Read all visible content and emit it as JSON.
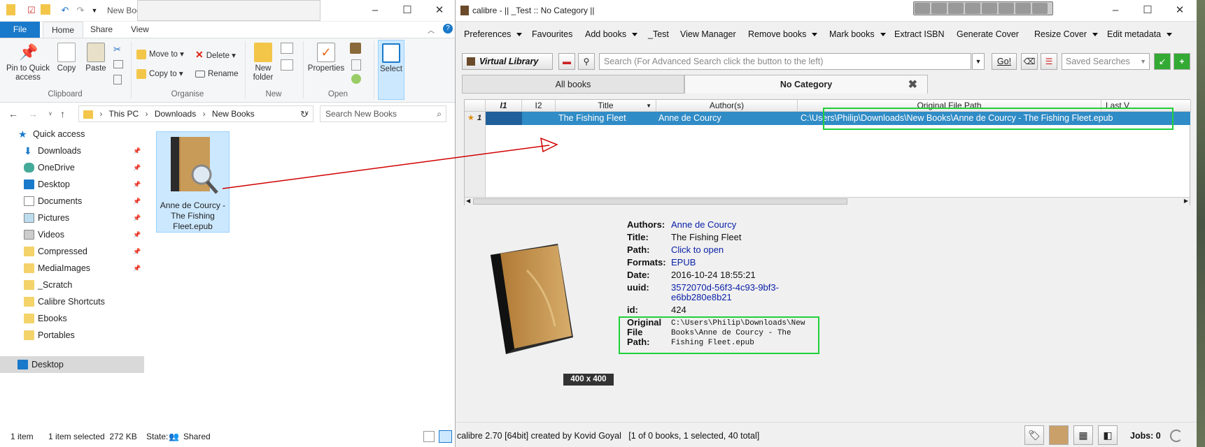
{
  "explorer": {
    "window_title": "New Books",
    "tabs": [
      "File",
      "Home",
      "Share",
      "View"
    ],
    "ribbon": {
      "clipboard": {
        "pin": "Pin to Quick access",
        "copy": "Copy",
        "paste": "Paste",
        "group": "Clipboard"
      },
      "organise": {
        "move_to": "Move to",
        "copy_to": "Copy to",
        "delete": "Delete",
        "rename": "Rename",
        "group": "Organise"
      },
      "new": {
        "new_folder": "New folder",
        "group": "New"
      },
      "open": {
        "properties": "Properties",
        "group": "Open"
      },
      "select": {
        "select": "Select"
      }
    },
    "breadcrumb": [
      "This PC",
      "Downloads",
      "New Books"
    ],
    "search_placeholder": "Search New Books",
    "nav_items": [
      {
        "label": "Quick access",
        "icon": "star-icon",
        "pinned": false
      },
      {
        "label": "Downloads",
        "icon": "download-icon",
        "pinned": true
      },
      {
        "label": "OneDrive",
        "icon": "cloud-icon",
        "pinned": true
      },
      {
        "label": "Desktop",
        "icon": "desktop-icon",
        "pinned": true
      },
      {
        "label": "Documents",
        "icon": "document-icon",
        "pinned": true
      },
      {
        "label": "Pictures",
        "icon": "picture-icon",
        "pinned": true
      },
      {
        "label": "Videos",
        "icon": "video-icon",
        "pinned": true
      },
      {
        "label": "Compressed",
        "icon": "folder-icon",
        "pinned": true
      },
      {
        "label": "MediaImages",
        "icon": "folder-icon",
        "pinned": true
      },
      {
        "label": "_Scratch",
        "icon": "folder-icon",
        "pinned": false
      },
      {
        "label": "Calibre Shortcuts",
        "icon": "folder-icon",
        "pinned": false
      },
      {
        "label": "Ebooks",
        "icon": "folder-icon",
        "pinned": false
      },
      {
        "label": "Portables",
        "icon": "folder-icon",
        "pinned": false
      },
      {
        "label": "Desktop",
        "icon": "desktop-icon",
        "pinned": false
      }
    ],
    "file": {
      "name": "Anne de Courcy - The Fishing Fleet.epub"
    },
    "status": {
      "items": "1 item",
      "selected": "1 item selected  272 KB",
      "state_label": "State:",
      "state_value": "Shared"
    }
  },
  "calibre": {
    "window_title": "calibre - || _Test :: No Category ||",
    "menu": [
      {
        "label": "Preferences",
        "arrow": true
      },
      {
        "label": "Favourites",
        "arrow": false
      },
      {
        "label": "Add books",
        "arrow": true
      },
      {
        "label": "_Test",
        "arrow": false
      },
      {
        "label": "View Manager",
        "arrow": false
      },
      {
        "label": "Remove books",
        "arrow": true
      },
      {
        "label": "Mark books",
        "arrow": true
      },
      {
        "label": "Extract ISBN",
        "arrow": false
      },
      {
        "label": "Generate Cover",
        "arrow": false
      },
      {
        "label": "Resize Cover",
        "arrow": true
      },
      {
        "label": "Edit metadata",
        "arrow": true
      }
    ],
    "virtual_library": "Virtual Library",
    "search_placeholder": "Search (For Advanced Search click the button to the left)",
    "go": "Go!",
    "saved_searches": "Saved Searches",
    "vl_tabs": [
      "All books",
      "No Category"
    ],
    "columns": [
      "I1",
      "I2",
      "Title",
      "Author(s)",
      "Original File Path",
      "Last V"
    ],
    "row": {
      "num": "1",
      "title": "The Fishing Fleet",
      "author": "Anne de Courcy",
      "path": "C:\\Users\\Philip\\Downloads\\New Books\\Anne de Courcy - The Fishing Fleet.epub"
    },
    "details": {
      "authors_label": "Authors:",
      "authors": "Anne de Courcy",
      "title_label": "Title:",
      "title": "The Fishing Fleet",
      "path_label": "Path:",
      "path": "Click to open",
      "formats_label": "Formats:",
      "formats": "EPUB",
      "date_label": "Date:",
      "date": "2016-10-24 18:55:21",
      "uuid_label": "uuid:",
      "uuid_1": "3572070d-56f3-4c93-9bf3-",
      "uuid_2": "e6bb280e8b21",
      "id_label": "id:",
      "id": "424",
      "ofp_label_1": "Original",
      "ofp_label_2": "File",
      "ofp_label_3": "Path:",
      "ofp_1": "C:\\Users\\Philip\\Downloads\\New",
      "ofp_2": "Books\\Anne de Courcy - The",
      "ofp_3": "Fishing Fleet.epub"
    },
    "cover_dims": "400 x 400",
    "status": "calibre 2.70 [64bit] created by Kovid Goyal   [1 of 0 books, 1 selected, 40 total]",
    "jobs": "Jobs: 0"
  },
  "colors": {
    "highlight": "#308cc6",
    "annotation_green": "#21d03a",
    "arrow_red": "#d10000",
    "explorer_accent": "#1979ca"
  }
}
